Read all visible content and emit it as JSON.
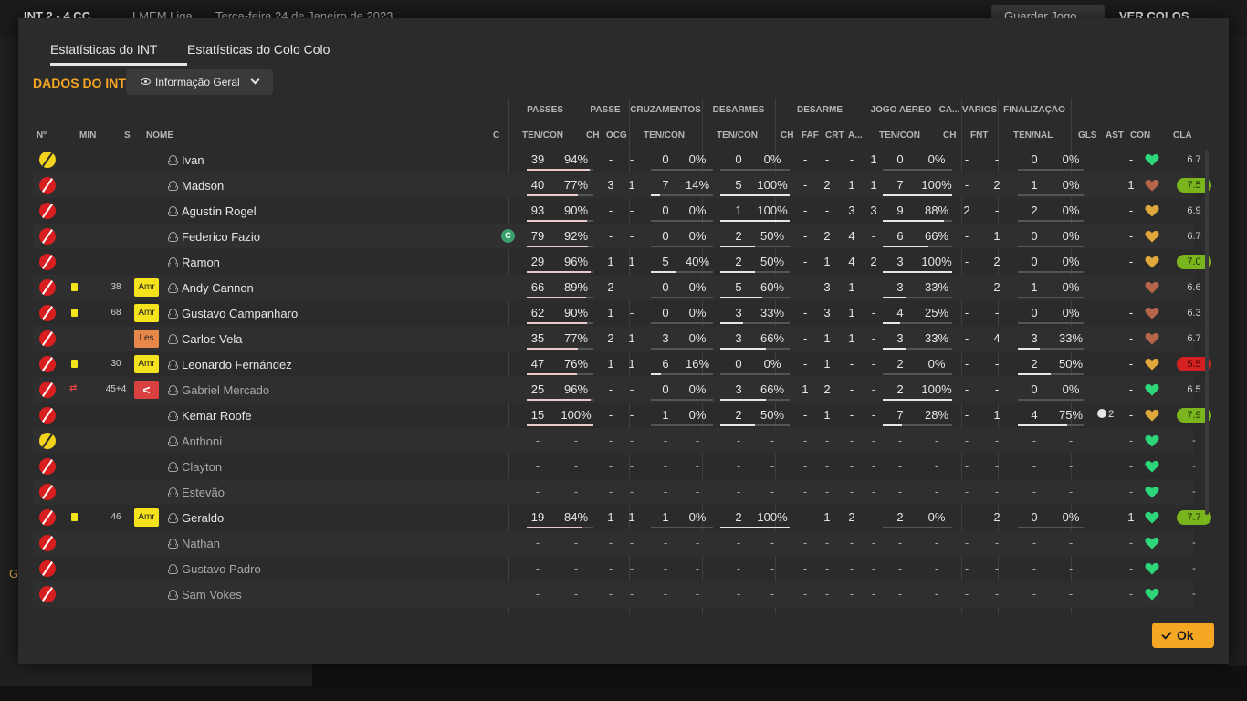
{
  "background": {
    "score": "INT  2 - 4  CC",
    "competition": "LMEM Liga",
    "date": "Terça-feira 24 de Janeiro de 2023",
    "save_label": "Guardar Jogo",
    "view_label": "VER COLOS",
    "side_letter": "G"
  },
  "tabs": [
    {
      "label": "Estatísticas do INT",
      "active": true
    },
    {
      "label": "Estatísticas do Colo Colo",
      "active": false
    }
  ],
  "section_title": "DADOS DO INT",
  "view_dropdown": {
    "label": "Informação Geral",
    "icon": "eye-icon"
  },
  "group_headers": {
    "passes": "PASSES",
    "passe": "PASSE",
    "cruzamentos": "CRUZAMENTOS",
    "desarmes": "DESARMES",
    "desarme": "DESARME",
    "jogo_aereo": "JOGO AÉREO",
    "ca": "CA...",
    "varios": "VÁRIOS",
    "finalizacao": "FINALIZAÇÃO"
  },
  "columns": {
    "no": "Nº",
    "min": "MIN",
    "s": "S",
    "nome": "NOME",
    "c": "C",
    "passes": "TEN/CON",
    "ch1": "CH",
    "ocg": "OCG",
    "cruz": "TEN/CON",
    "des": "TEN/CON",
    "ch2": "CH",
    "faf": "FAF",
    "crt": "CRT",
    "a": "A...",
    "aereo": "TEN/CON",
    "ch3": "CH",
    "fnt": "FNT",
    "fin": "TEN/NAL",
    "gls": "GLS",
    "ast": "AST",
    "con": "CON",
    "cla": "CLA"
  },
  "colors": {
    "accent": "#f5a623",
    "rating_good": "#7ab51d",
    "rating_bad": "#d42020",
    "heart_green": "#2ed67a",
    "heart_brown": "#b5654a",
    "heart_gold": "#e0a83a",
    "amr": "#f4e21c",
    "les": "#e8874a"
  },
  "players": [
    {
      "name": "Ivan",
      "gk": true,
      "card": "",
      "min": "",
      "badge": "",
      "cap": false,
      "sub": false,
      "passes": [
        "39",
        "94%"
      ],
      "passes_pct": 0.94,
      "ch1": "-",
      "ocg": "-",
      "cruz": [
        "0",
        "0%"
      ],
      "cruz_pct": 0,
      "des": [
        "0",
        "0%"
      ],
      "des_pct": 0,
      "ch2": "-",
      "faf": "-",
      "crt": "-",
      "a": "1",
      "aereo": [
        "0",
        "0%"
      ],
      "aereo_pct": 0,
      "ch3": "-",
      "fnt": "-",
      "fin": [
        "0",
        "0%"
      ],
      "fin_pct": 0,
      "gls": "",
      "ast": "-",
      "heart": "green",
      "rating": "6.7",
      "rating_style": "plain"
    },
    {
      "name": "Madson",
      "gk": false,
      "card": "",
      "min": "",
      "badge": "",
      "cap": false,
      "sub": false,
      "passes": [
        "40",
        "77%"
      ],
      "passes_pct": 0.77,
      "ch1": "3",
      "ocg": "1",
      "cruz": [
        "7",
        "14%"
      ],
      "cruz_pct": 0.14,
      "des": [
        "5",
        "100%"
      ],
      "des_pct": 1,
      "ch2": "-",
      "faf": "2",
      "crt": "1",
      "a": "1",
      "aereo": [
        "7",
        "100%"
      ],
      "aereo_pct": 1,
      "ch3": "-",
      "fnt": "2",
      "fin": [
        "1",
        "0%"
      ],
      "fin_pct": 0,
      "gls": "",
      "ast": "1",
      "heart": "brown",
      "rating": "7.5",
      "rating_style": "good"
    },
    {
      "name": "Agustín Rogel",
      "gk": false,
      "card": "",
      "min": "",
      "badge": "",
      "cap": false,
      "sub": false,
      "passes": [
        "93",
        "90%"
      ],
      "passes_pct": 0.9,
      "ch1": "-",
      "ocg": "-",
      "cruz": [
        "0",
        "0%"
      ],
      "cruz_pct": 0,
      "des": [
        "1",
        "100%"
      ],
      "des_pct": 1,
      "ch2": "-",
      "faf": "-",
      "crt": "3",
      "a": "3",
      "aereo": [
        "9",
        "88%"
      ],
      "aereo_pct": 0.88,
      "ch3": "2",
      "fnt": "-",
      "fin": [
        "2",
        "0%"
      ],
      "fin_pct": 0,
      "gls": "",
      "ast": "-",
      "heart": "gold",
      "rating": "6.9",
      "rating_style": "plain"
    },
    {
      "name": "Federico Fazio",
      "gk": false,
      "card": "",
      "min": "",
      "badge": "",
      "cap": true,
      "sub": false,
      "passes": [
        "79",
        "92%"
      ],
      "passes_pct": 0.92,
      "ch1": "-",
      "ocg": "-",
      "cruz": [
        "0",
        "0%"
      ],
      "cruz_pct": 0,
      "des": [
        "2",
        "50%"
      ],
      "des_pct": 0.5,
      "ch2": "-",
      "faf": "2",
      "crt": "4",
      "a": "-",
      "aereo": [
        "6",
        "66%"
      ],
      "aereo_pct": 0.66,
      "ch3": "-",
      "fnt": "1",
      "fin": [
        "0",
        "0%"
      ],
      "fin_pct": 0,
      "gls": "",
      "ast": "-",
      "heart": "gold",
      "rating": "6.7",
      "rating_style": "plain"
    },
    {
      "name": "Ramon",
      "gk": false,
      "card": "",
      "min": "",
      "badge": "",
      "cap": false,
      "sub": false,
      "passes": [
        "29",
        "96%"
      ],
      "passes_pct": 0.96,
      "ch1": "1",
      "ocg": "1",
      "cruz": [
        "5",
        "40%"
      ],
      "cruz_pct": 0.4,
      "des": [
        "2",
        "50%"
      ],
      "des_pct": 0.5,
      "ch2": "-",
      "faf": "1",
      "crt": "4",
      "a": "2",
      "aereo": [
        "3",
        "100%"
      ],
      "aereo_pct": 1,
      "ch3": "-",
      "fnt": "2",
      "fin": [
        "0",
        "0%"
      ],
      "fin_pct": 0,
      "gls": "",
      "ast": "-",
      "heart": "gold",
      "rating": "7.0",
      "rating_style": "good"
    },
    {
      "name": "Andy Cannon",
      "gk": false,
      "card": "yellow",
      "min": "38",
      "badge": "Amr",
      "cap": false,
      "sub": false,
      "passes": [
        "66",
        "89%"
      ],
      "passes_pct": 0.89,
      "ch1": "2",
      "ocg": "-",
      "cruz": [
        "0",
        "0%"
      ],
      "cruz_pct": 0,
      "des": [
        "5",
        "60%"
      ],
      "des_pct": 0.6,
      "ch2": "-",
      "faf": "3",
      "crt": "1",
      "a": "-",
      "aereo": [
        "3",
        "33%"
      ],
      "aereo_pct": 0.33,
      "ch3": "-",
      "fnt": "2",
      "fin": [
        "1",
        "0%"
      ],
      "fin_pct": 0,
      "gls": "",
      "ast": "-",
      "heart": "brown",
      "rating": "6.6",
      "rating_style": "plain"
    },
    {
      "name": "Gustavo Campanharo",
      "gk": false,
      "card": "yellow",
      "min": "68",
      "badge": "Amr",
      "cap": false,
      "sub": false,
      "passes": [
        "62",
        "90%"
      ],
      "passes_pct": 0.9,
      "ch1": "1",
      "ocg": "-",
      "cruz": [
        "0",
        "0%"
      ],
      "cruz_pct": 0,
      "des": [
        "3",
        "33%"
      ],
      "des_pct": 0.33,
      "ch2": "-",
      "faf": "3",
      "crt": "1",
      "a": "-",
      "aereo": [
        "4",
        "25%"
      ],
      "aereo_pct": 0.25,
      "ch3": "-",
      "fnt": "-",
      "fin": [
        "0",
        "0%"
      ],
      "fin_pct": 0,
      "gls": "",
      "ast": "-",
      "heart": "brown",
      "rating": "6.3",
      "rating_style": "plain"
    },
    {
      "name": "Carlos Vela",
      "gk": false,
      "card": "",
      "min": "",
      "badge": "Les",
      "cap": false,
      "sub": false,
      "passes": [
        "35",
        "77%"
      ],
      "passes_pct": 0.77,
      "ch1": "2",
      "ocg": "1",
      "cruz": [
        "3",
        "0%"
      ],
      "cruz_pct": 0,
      "des": [
        "3",
        "66%"
      ],
      "des_pct": 0.66,
      "ch2": "-",
      "faf": "1",
      "crt": "1",
      "a": "-",
      "aereo": [
        "3",
        "33%"
      ],
      "aereo_pct": 0.33,
      "ch3": "-",
      "fnt": "4",
      "fin": [
        "3",
        "33%"
      ],
      "fin_pct": 0.33,
      "gls": "",
      "ast": "-",
      "heart": "brown",
      "rating": "6.7",
      "rating_style": "plain"
    },
    {
      "name": "Leonardo Fernández",
      "gk": false,
      "card": "yellow",
      "min": "30",
      "badge": "Amr",
      "cap": false,
      "sub": false,
      "passes": [
        "47",
        "76%"
      ],
      "passes_pct": 0.76,
      "ch1": "1",
      "ocg": "1",
      "cruz": [
        "6",
        "16%"
      ],
      "cruz_pct": 0.16,
      "des": [
        "0",
        "0%"
      ],
      "des_pct": 0,
      "ch2": "-",
      "faf": "1",
      "crt": "-",
      "a": "-",
      "aereo": [
        "2",
        "0%"
      ],
      "aereo_pct": 0,
      "ch3": "-",
      "fnt": "-",
      "fin": [
        "2",
        "50%"
      ],
      "fin_pct": 0.5,
      "gls": "",
      "ast": "-",
      "heart": "gold",
      "rating": "5.5",
      "rating_style": "bad"
    },
    {
      "name": "Gabriel Mercado",
      "gk": false,
      "card": "subst",
      "min": "45+4",
      "badge": "<",
      "cap": false,
      "sub": true,
      "passes": [
        "25",
        "96%"
      ],
      "passes_pct": 0.96,
      "ch1": "-",
      "ocg": "-",
      "cruz": [
        "0",
        "0%"
      ],
      "cruz_pct": 0,
      "des": [
        "3",
        "66%"
      ],
      "des_pct": 0.66,
      "ch2": "1",
      "faf": "2",
      "crt": "-",
      "a": "-",
      "aereo": [
        "2",
        "100%"
      ],
      "aereo_pct": 1,
      "ch3": "-",
      "fnt": "-",
      "fin": [
        "0",
        "0%"
      ],
      "fin_pct": 0,
      "gls": "",
      "ast": "-",
      "heart": "green",
      "rating": "6.5",
      "rating_style": "plain"
    },
    {
      "name": "Kemar Roofe",
      "gk": false,
      "card": "",
      "min": "",
      "badge": "",
      "cap": false,
      "sub": false,
      "passes": [
        "15",
        "100%"
      ],
      "passes_pct": 1,
      "ch1": "-",
      "ocg": "-",
      "cruz": [
        "1",
        "0%"
      ],
      "cruz_pct": 0,
      "des": [
        "2",
        "50%"
      ],
      "des_pct": 0.5,
      "ch2": "-",
      "faf": "1",
      "crt": "-",
      "a": "-",
      "aereo": [
        "7",
        "28%"
      ],
      "aereo_pct": 0.28,
      "ch3": "-",
      "fnt": "1",
      "fin": [
        "4",
        "75%"
      ],
      "fin_pct": 0.75,
      "gls": "2",
      "ast": "-",
      "heart": "gold",
      "rating": "7.9",
      "rating_style": "good"
    },
    {
      "name": "Anthoni",
      "gk": true,
      "card": "",
      "min": "",
      "badge": "",
      "cap": false,
      "sub": false,
      "unused": true,
      "heart": "green",
      "rating": "-",
      "rating_style": "plain"
    },
    {
      "name": "Clayton",
      "gk": false,
      "card": "",
      "min": "",
      "badge": "",
      "cap": false,
      "sub": false,
      "unused": true,
      "heart": "green",
      "rating": "-",
      "rating_style": "plain"
    },
    {
      "name": "Estevão",
      "gk": false,
      "card": "",
      "min": "",
      "badge": "",
      "cap": false,
      "sub": false,
      "unused": true,
      "heart": "green",
      "rating": "-",
      "rating_style": "plain"
    },
    {
      "name": "Geraldo",
      "gk": false,
      "card": "yellow",
      "min": "46",
      "badge": "Amr",
      "cap": false,
      "sub": false,
      "passes": [
        "19",
        "84%"
      ],
      "passes_pct": 0.84,
      "ch1": "1",
      "ocg": "1",
      "cruz": [
        "1",
        "0%"
      ],
      "cruz_pct": 0,
      "des": [
        "2",
        "100%"
      ],
      "des_pct": 1,
      "ch2": "-",
      "faf": "1",
      "crt": "2",
      "a": "-",
      "aereo": [
        "2",
        "0%"
      ],
      "aereo_pct": 0,
      "ch3": "-",
      "fnt": "2",
      "fin": [
        "0",
        "0%"
      ],
      "fin_pct": 0,
      "gls": "",
      "ast": "1",
      "heart": "green",
      "rating": "7.7",
      "rating_style": "good"
    },
    {
      "name": "Nathan",
      "gk": false,
      "card": "",
      "min": "",
      "badge": "",
      "cap": false,
      "sub": false,
      "unused": true,
      "heart": "green",
      "rating": "-",
      "rating_style": "plain"
    },
    {
      "name": "Gustavo Padro",
      "gk": false,
      "card": "",
      "min": "",
      "badge": "",
      "cap": false,
      "sub": false,
      "unused": true,
      "heart": "green",
      "rating": "-",
      "rating_style": "plain"
    },
    {
      "name": "Sam Vokes",
      "gk": false,
      "card": "",
      "min": "",
      "badge": "",
      "cap": false,
      "sub": false,
      "unused": true,
      "heart": "green",
      "rating": "-",
      "rating_style": "plain"
    }
  ],
  "ok_label": "Ok"
}
